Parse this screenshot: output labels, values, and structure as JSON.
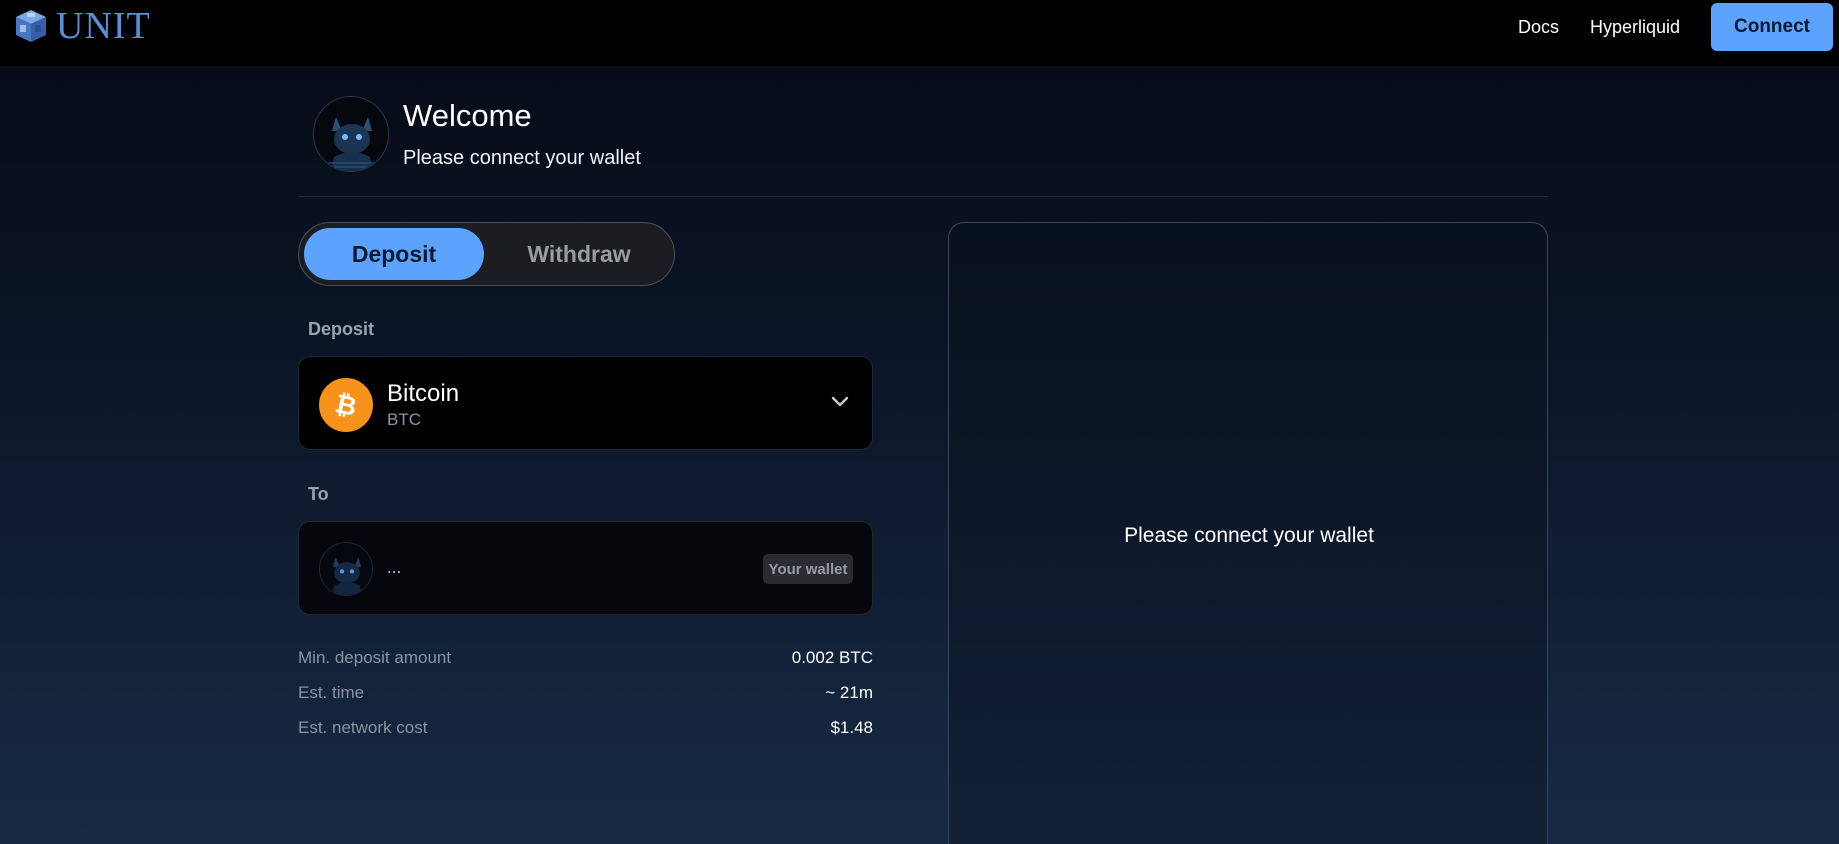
{
  "header": {
    "logo_text": "UNIT",
    "nav": {
      "docs": "Docs",
      "hyperliquid": "Hyperliquid"
    },
    "connect_label": "Connect"
  },
  "welcome": {
    "title": "Welcome",
    "subtitle": "Please connect your wallet"
  },
  "tabs": {
    "deposit": "Deposit",
    "withdraw": "Withdraw",
    "active": "Deposit"
  },
  "form": {
    "deposit_label": "Deposit",
    "asset": {
      "name": "Bitcoin",
      "ticker": "BTC",
      "icon": "bitcoin-icon"
    },
    "to_label": "To",
    "wallet": {
      "address": "...",
      "badge": "Your wallet"
    }
  },
  "info": {
    "min_deposit_label": "Min. deposit amount",
    "min_deposit_value": "0.002 BTC",
    "est_time_label": "Est. time",
    "est_time_value": "~ 21m",
    "network_cost_label": "Est. network cost",
    "network_cost_value": "$1.48"
  },
  "panel": {
    "message": "Please connect your wallet"
  },
  "colors": {
    "accent": "#5ba3ff",
    "bitcoin": "#f7931a",
    "logo": "#5b8fd6"
  }
}
